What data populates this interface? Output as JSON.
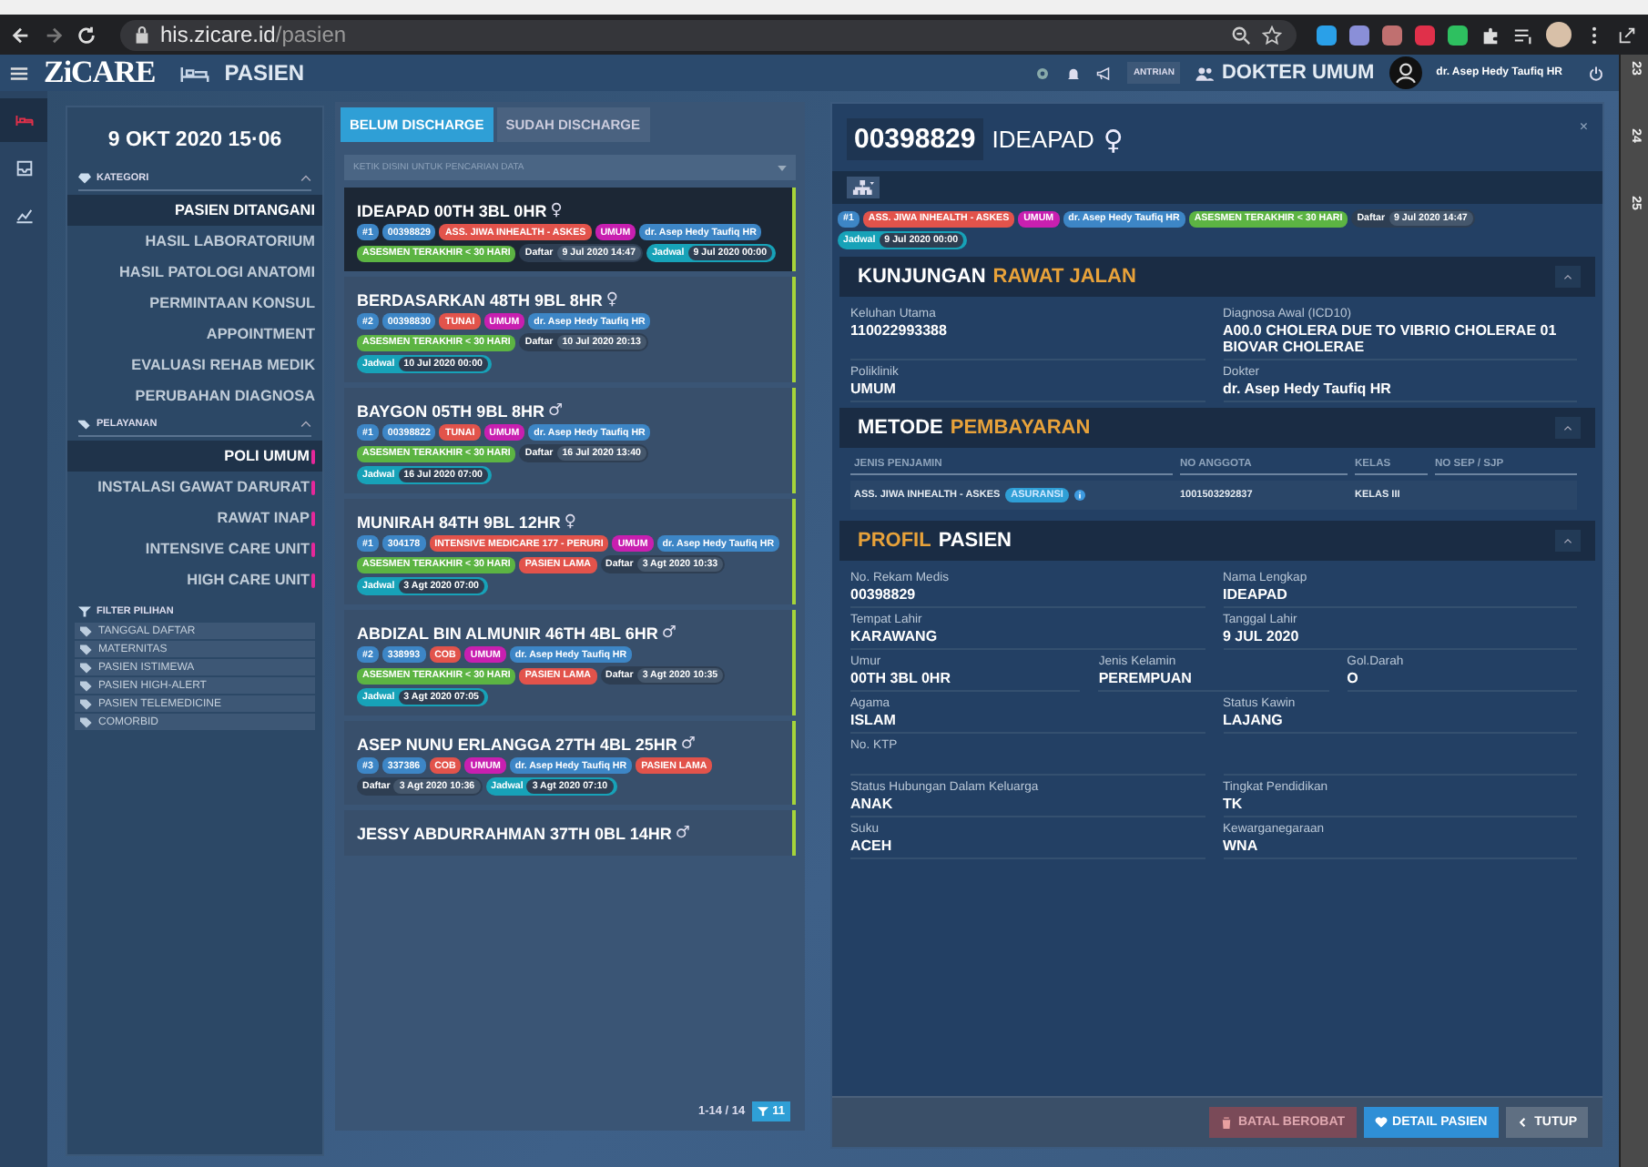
{
  "browser": {
    "url_host": "his.zicare.id",
    "url_path": "/pasien"
  },
  "header": {
    "logo": "ZiCARE",
    "page_title": "PASIEN",
    "queue_button": "ANTRIAN",
    "role": "DOKTER UMUM",
    "user": "dr. Asep Hedy Taufiq HR"
  },
  "ruler": [
    "23",
    "24",
    "25"
  ],
  "rail": [
    {
      "selected": true
    },
    {
      "selected": false
    },
    {
      "selected": false
    }
  ],
  "sidebar": {
    "date": "9 OKT 2020 15·06",
    "sections": [
      {
        "title": "KATEGORI",
        "expanded": true,
        "marked": false,
        "items": [
          {
            "label": "PASIEN DITANGANI",
            "selected": true
          },
          {
            "label": "HASIL LABORATORIUM",
            "selected": false
          },
          {
            "label": "HASIL PATOLOGI ANATOMI",
            "selected": false
          },
          {
            "label": "PERMINTAAN KONSUL",
            "selected": false
          },
          {
            "label": "APPOINTMENT",
            "selected": false
          },
          {
            "label": "EVALUASI REHAB MEDIK",
            "selected": false
          },
          {
            "label": "PERUBAHAN DIAGNOSA",
            "selected": false
          }
        ]
      },
      {
        "title": "PELAYANAN",
        "expanded": true,
        "marked": true,
        "items": [
          {
            "label": "POLI UMUM",
            "selected": true
          },
          {
            "label": "INSTALASI GAWAT DARURAT",
            "selected": false
          },
          {
            "label": "RAWAT INAP",
            "selected": false
          },
          {
            "label": "INTENSIVE CARE UNIT",
            "selected": false
          },
          {
            "label": "HIGH CARE UNIT",
            "selected": false
          }
        ]
      }
    ],
    "filter": {
      "title": "FILTER PILIHAN",
      "items": [
        "TANGGAL DAFTAR",
        "MATERNITAS",
        "PASIEN ISTIMEWA",
        "PASIEN HIGH-ALERT",
        "PASIEN TELEMEDICINE",
        "COMORBID"
      ]
    }
  },
  "list": {
    "tabs": [
      {
        "label": "BELUM DISCHARGE",
        "selected": true
      },
      {
        "label": "SUDAH DISCHARGE",
        "selected": false
      }
    ],
    "search": {
      "placeholder": "KETIK DISINI UNTUK PENCARIAN DATA"
    },
    "patients": [
      {
        "name": "IDEAPAD 00TH 3BL 0HR",
        "sex_symbol": "♀",
        "selected": true,
        "chips": [
          {
            "kind": "tag",
            "text": "#1",
            "color": "#3d86c6"
          },
          {
            "kind": "tag",
            "text": "00398829",
            "color": "#3d86c6"
          },
          {
            "kind": "tag",
            "text": "ASS. JIWA INHEALTH - ASKES",
            "color": "#e2534b"
          },
          {
            "kind": "tag",
            "text": "UMUM",
            "color": "#c81fb0"
          },
          {
            "kind": "tag",
            "text": "dr. Asep Hedy Taufiq HR",
            "color": "#3d86c6"
          },
          {
            "kind": "tag",
            "text": "ASESMEN TERAKHIR < 30 HARI",
            "color": "#5cb443"
          },
          {
            "kind": "date",
            "label": "Daftar",
            "value": "9 Jul 2020 14:47"
          },
          {
            "kind": "schedule",
            "label": "Jadwal",
            "value": "9 Jul 2020 00:00"
          }
        ]
      },
      {
        "name": "BERDASARKAN 48TH 9BL 8HR",
        "sex_symbol": "♀",
        "selected": false,
        "chips": [
          {
            "kind": "tag",
            "text": "#2",
            "color": "#3d86c6"
          },
          {
            "kind": "tag",
            "text": "00398830",
            "color": "#3d86c6"
          },
          {
            "kind": "tag",
            "text": "TUNAI",
            "color": "#e2534b"
          },
          {
            "kind": "tag",
            "text": "UMUM",
            "color": "#c81fb0"
          },
          {
            "kind": "tag",
            "text": "dr. Asep Hedy Taufiq HR",
            "color": "#3d86c6"
          },
          {
            "kind": "tag",
            "text": "ASESMEN TERAKHIR < 30 HARI",
            "color": "#5cb443"
          },
          {
            "kind": "date",
            "label": "Daftar",
            "value": "10 Jul 2020 20:13"
          },
          {
            "kind": "schedule",
            "label": "Jadwal",
            "value": "10 Jul 2020 00:00"
          }
        ]
      },
      {
        "name": "BAYGON 05TH 9BL 8HR",
        "sex_symbol": "♂",
        "selected": false,
        "chips": [
          {
            "kind": "tag",
            "text": "#1",
            "color": "#3d86c6"
          },
          {
            "kind": "tag",
            "text": "00398822",
            "color": "#3d86c6"
          },
          {
            "kind": "tag",
            "text": "TUNAI",
            "color": "#e2534b"
          },
          {
            "kind": "tag",
            "text": "UMUM",
            "color": "#c81fb0"
          },
          {
            "kind": "tag",
            "text": "dr. Asep Hedy Taufiq HR",
            "color": "#3d86c6"
          },
          {
            "kind": "tag",
            "text": "ASESMEN TERAKHIR < 30 HARI",
            "color": "#5cb443"
          },
          {
            "kind": "date",
            "label": "Daftar",
            "value": "16 Jul 2020 13:40"
          },
          {
            "kind": "schedule",
            "label": "Jadwal",
            "value": "16 Jul 2020 07:00"
          }
        ]
      },
      {
        "name": "MUNIRAH 84TH 9BL 12HR",
        "sex_symbol": "♀",
        "selected": false,
        "chips": [
          {
            "kind": "tag",
            "text": "#1",
            "color": "#3d86c6"
          },
          {
            "kind": "tag",
            "text": "304178",
            "color": "#3d86c6"
          },
          {
            "kind": "tag",
            "text": "INTENSIVE MEDICARE 177 - PERURI",
            "color": "#e2534b"
          },
          {
            "kind": "tag",
            "text": "UMUM",
            "color": "#c81fb0"
          },
          {
            "kind": "tag",
            "text": "dr. Asep Hedy Taufiq HR",
            "color": "#3d86c6"
          },
          {
            "kind": "tag",
            "text": "ASESMEN TERAKHIR < 30 HARI",
            "color": "#5cb443"
          },
          {
            "kind": "tag",
            "text": "PASIEN LAMA",
            "color": "#e2534b"
          },
          {
            "kind": "date",
            "label": "Daftar",
            "value": "3 Agt 2020 10:33"
          },
          {
            "kind": "schedule",
            "label": "Jadwal",
            "value": "3 Agt 2020 07:00"
          }
        ]
      },
      {
        "name": "ABDIZAL BIN ALMUNIR 46TH 4BL 6HR",
        "sex_symbol": "♂",
        "selected": false,
        "chips": [
          {
            "kind": "tag",
            "text": "#2",
            "color": "#3d86c6"
          },
          {
            "kind": "tag",
            "text": "338993",
            "color": "#3d86c6"
          },
          {
            "kind": "tag",
            "text": "COB",
            "color": "#e2534b"
          },
          {
            "kind": "tag",
            "text": "UMUM",
            "color": "#c81fb0"
          },
          {
            "kind": "tag",
            "text": "dr. Asep Hedy Taufiq HR",
            "color": "#3d86c6"
          },
          {
            "kind": "tag",
            "text": "ASESMEN TERAKHIR < 30 HARI",
            "color": "#5cb443"
          },
          {
            "kind": "tag",
            "text": "PASIEN LAMA",
            "color": "#e2534b"
          },
          {
            "kind": "date",
            "label": "Daftar",
            "value": "3 Agt 2020 10:35"
          },
          {
            "kind": "schedule",
            "label": "Jadwal",
            "value": "3 Agt 2020 07:05"
          }
        ]
      },
      {
        "name": "ASEP NUNU ERLANGGA 27TH 4BL 25HR",
        "sex_symbol": "♂",
        "selected": false,
        "chips": [
          {
            "kind": "tag",
            "text": "#3",
            "color": "#3d86c6"
          },
          {
            "kind": "tag",
            "text": "337386",
            "color": "#3d86c6"
          },
          {
            "kind": "tag",
            "text": "COB",
            "color": "#e2534b"
          },
          {
            "kind": "tag",
            "text": "UMUM",
            "color": "#c81fb0"
          },
          {
            "kind": "tag",
            "text": "dr. Asep Hedy Taufiq HR",
            "color": "#3d86c6"
          },
          {
            "kind": "tag",
            "text": "PASIEN LAMA",
            "color": "#e2534b"
          },
          {
            "kind": "date",
            "label": "Daftar",
            "value": "3 Agt 2020 10:36"
          },
          {
            "kind": "schedule",
            "label": "Jadwal",
            "value": "3 Agt 2020 07:10"
          }
        ]
      },
      {
        "name": "JESSY ABDURRAHMAN 37TH 0BL 14HR",
        "sex_symbol": "♂",
        "selected": false
      }
    ],
    "pagination": "1-14 / 14",
    "filter_count": "11"
  },
  "detail": {
    "record_number": "00398829",
    "name": "IDEAPAD",
    "sex_symbol": "♀",
    "close": "×",
    "chips": [
      {
        "kind": "tag",
        "text": "#1",
        "color": "#3d86c6"
      },
      {
        "kind": "tag",
        "text": "ASS. JIWA INHEALTH - ASKES",
        "color": "#e2534b"
      },
      {
        "kind": "tag",
        "text": "UMUM",
        "color": "#c81fb0"
      },
      {
        "kind": "tag",
        "text": "dr. Asep Hedy Taufiq HR",
        "color": "#3d86c6"
      },
      {
        "kind": "tag",
        "text": "ASESMEN TERAKHIR < 30 HARI",
        "color": "#5cb443"
      },
      {
        "kind": "date",
        "label": "Daftar",
        "value": "9 Jul 2020 14:47"
      },
      {
        "kind": "schedule",
        "label": "Jadwal",
        "value": "9 Jul 2020 00:00"
      }
    ],
    "visit": {
      "title": [
        {
          "text": "KUNJUNGAN",
          "accent": false
        },
        {
          "text": "RAWAT JALAN",
          "accent": true
        }
      ],
      "rows": [
        [
          {
            "label": "Keluhan Utama",
            "value": "110022993388"
          },
          {
            "label": "Diagnosa Awal (ICD10)",
            "value": "A00.0 CHOLERA DUE TO VIBRIO CHOLERAE 01 BIOVAR CHOLERAE"
          }
        ],
        [
          {
            "label": "Poliklinik",
            "value": "UMUM"
          },
          {
            "label": "Dokter",
            "value": "dr. Asep Hedy Taufiq HR"
          }
        ]
      ]
    },
    "payment": {
      "title": [
        {
          "text": "METODE",
          "accent": false
        },
        {
          "text": "PEMBAYARAN",
          "accent": true
        }
      ],
      "columns": [
        "JENIS PENJAMIN",
        "NO ANGGOTA",
        "KELAS",
        "NO SEP / SJP"
      ],
      "rows": [
        {
          "guarantor": "ASS. JIWA INHEALTH - ASKES",
          "badge": "ASURANSI",
          "member_no": "1001503292837",
          "class": "KELAS III"
        }
      ]
    },
    "profile": {
      "title": [
        {
          "text": "PROFIL",
          "accent": true
        },
        {
          "text": "PASIEN",
          "accent": false
        }
      ],
      "rows": [
        [
          {
            "label": "No. Rekam Medis",
            "value": "00398829"
          },
          {
            "label": "Nama Lengkap",
            "value": "IDEAPAD"
          }
        ],
        [
          {
            "label": "Tempat Lahir",
            "value": "KARAWANG"
          },
          {
            "label": "Tanggal Lahir",
            "value": "9 JUL 2020"
          }
        ],
        [
          {
            "label": "Umur",
            "value": "00TH 3BL 0HR"
          },
          {
            "label": "Jenis Kelamin",
            "value": "PEREMPUAN"
          },
          {
            "label": "Gol.Darah",
            "value": "O"
          }
        ],
        [
          {
            "label": "Agama",
            "value": "ISLAM"
          },
          {
            "label": "Status Kawin",
            "value": "LAJANG"
          }
        ],
        [
          {
            "label": "No. KTP"
          }
        ],
        [
          {
            "label": "Status Hubungan Dalam Keluarga",
            "value": "ANAK"
          },
          {
            "label": "Tingkat Pendidikan",
            "value": "TK"
          }
        ],
        [
          {
            "label": "Suku",
            "value": "ACEH"
          },
          {
            "label": "Kewarganegaraan",
            "value": "WNA"
          }
        ]
      ]
    },
    "buttons": [
      {
        "label": "BATAL BEROBAT",
        "kind": "danger"
      },
      {
        "label": "DETAIL PASIEN",
        "kind": "primary"
      },
      {
        "label": "TUTUP",
        "kind": "back"
      }
    ]
  }
}
